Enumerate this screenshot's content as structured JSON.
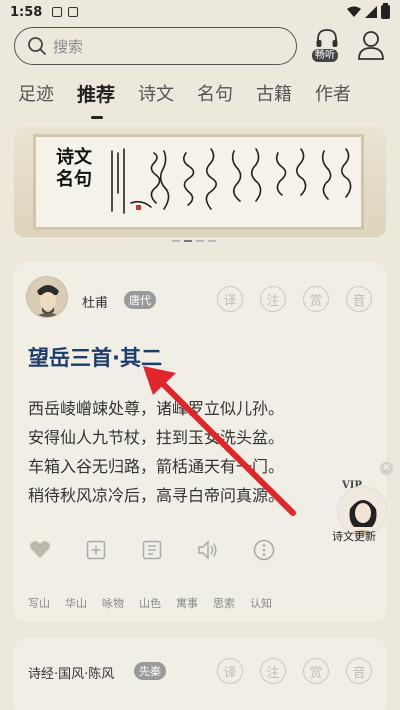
{
  "status": {
    "time": "1:58"
  },
  "search": {
    "placeholder": "搜索"
  },
  "header": {
    "listen_label": "畅听"
  },
  "tabs": [
    "足迹",
    "推荐",
    "诗文",
    "名句",
    "古籍",
    "作者"
  ],
  "banner": {
    "title": "诗文名句"
  },
  "poem": {
    "author": "杜甫",
    "dynasty": "唐代",
    "circle_actions": [
      "译",
      "注",
      "赏",
      "音"
    ],
    "title": "望岳三首·其二",
    "lines": [
      "西岳崚嶒竦处尊，诸峰罗立似儿孙。",
      "安得仙人九节杖，拄到玉女洗头盆。",
      "车箱入谷无归路，箭栝通天有一门。",
      "稍待秋风凉冷后，高寻白帝问真源。"
    ],
    "tags": [
      "写山",
      "华山",
      "咏物",
      "山色",
      "寓事",
      "思索",
      "认知"
    ]
  },
  "next_poem": {
    "source": "诗经·国风·陈风",
    "dynasty": "先秦",
    "circle_actions": [
      "译",
      "注",
      "赏",
      "音"
    ]
  },
  "floating_badge": {
    "vip": "VIP",
    "caption": "诗文更新"
  },
  "colors": {
    "accent_title": "#1d3d6b",
    "arrow": "#e0262a",
    "background": "#ece8dc"
  }
}
